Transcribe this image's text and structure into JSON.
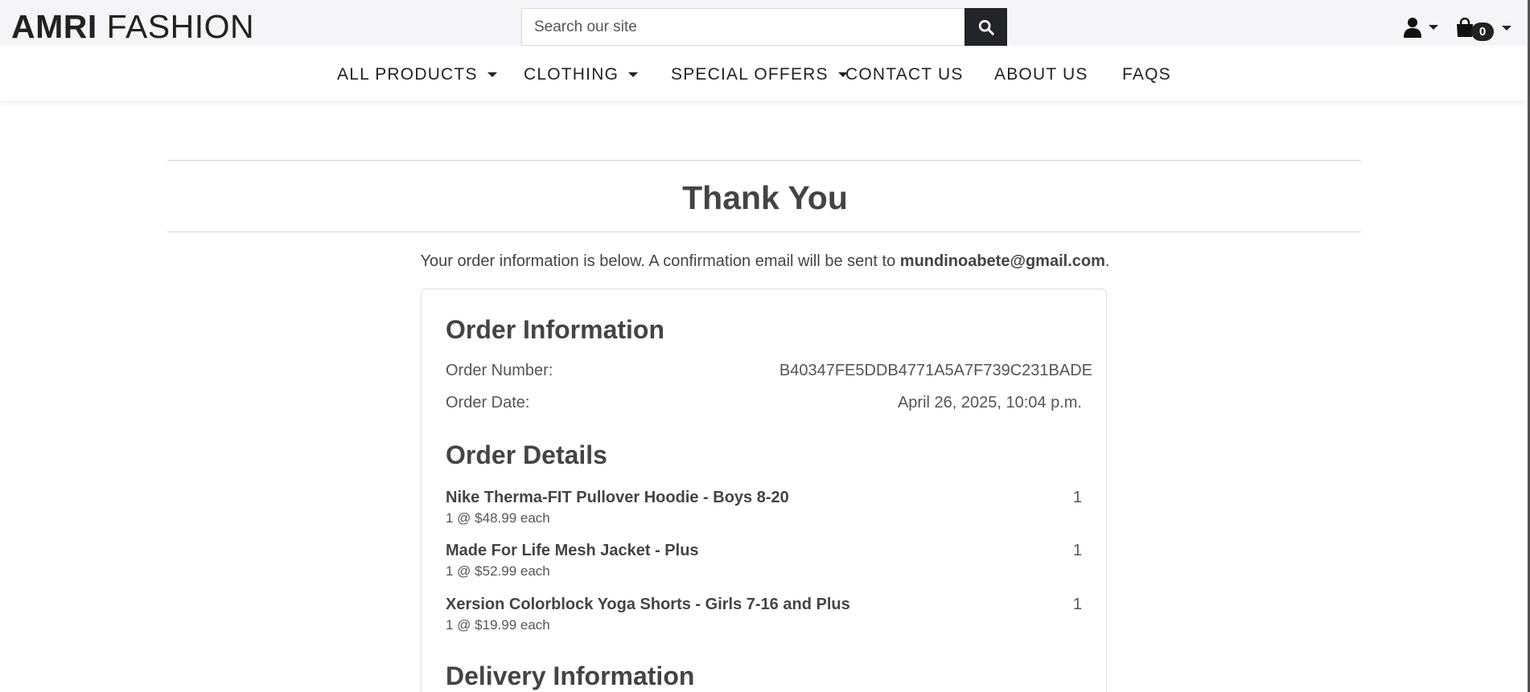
{
  "header": {
    "logo_bold": "AMRI",
    "logo_light": "FASHION",
    "search_placeholder": "Search our site",
    "cart_count": "0"
  },
  "nav": {
    "items": [
      {
        "label": "ALL PRODUCTS",
        "dropdown": true
      },
      {
        "label": "CLOTHING",
        "dropdown": true
      },
      {
        "label": "SPECIAL OFFERS",
        "dropdown": true
      },
      {
        "label": "CONTACT US",
        "dropdown": false
      },
      {
        "label": "ABOUT US",
        "dropdown": false
      },
      {
        "label": "FAQS",
        "dropdown": false
      }
    ]
  },
  "main": {
    "title": "Thank You",
    "intro_text": "Your order information is below. A confirmation email will be sent to ",
    "email": "mundinoabete@gmail.com",
    "intro_end": "."
  },
  "order_info": {
    "heading": "Order Information",
    "number_label": "Order Number:",
    "number_value": "B40347FE5DDB4771A5A7F739C231BADE",
    "date_label": "Order Date:",
    "date_value": "April 26, 2025, 10:04 p.m."
  },
  "order_details": {
    "heading": "Order Details",
    "items": [
      {
        "name": "Nike Therma-FIT Pullover Hoodie - Boys 8-20",
        "price_line": "1 @ $48.99 each",
        "qty": "1"
      },
      {
        "name": "Made For Life Mesh Jacket - Plus",
        "price_line": "1 @ $52.99 each",
        "qty": "1"
      },
      {
        "name": "Xersion Colorblock Yoga Shorts - Girls 7-16 and Plus",
        "price_line": "1 @ $19.99 each",
        "qty": "1"
      }
    ]
  },
  "delivery": {
    "heading": "Delivery Information"
  },
  "colors": {
    "topbar_bg": "#f4f5f8",
    "dark": "#212529",
    "text": "#444444"
  }
}
